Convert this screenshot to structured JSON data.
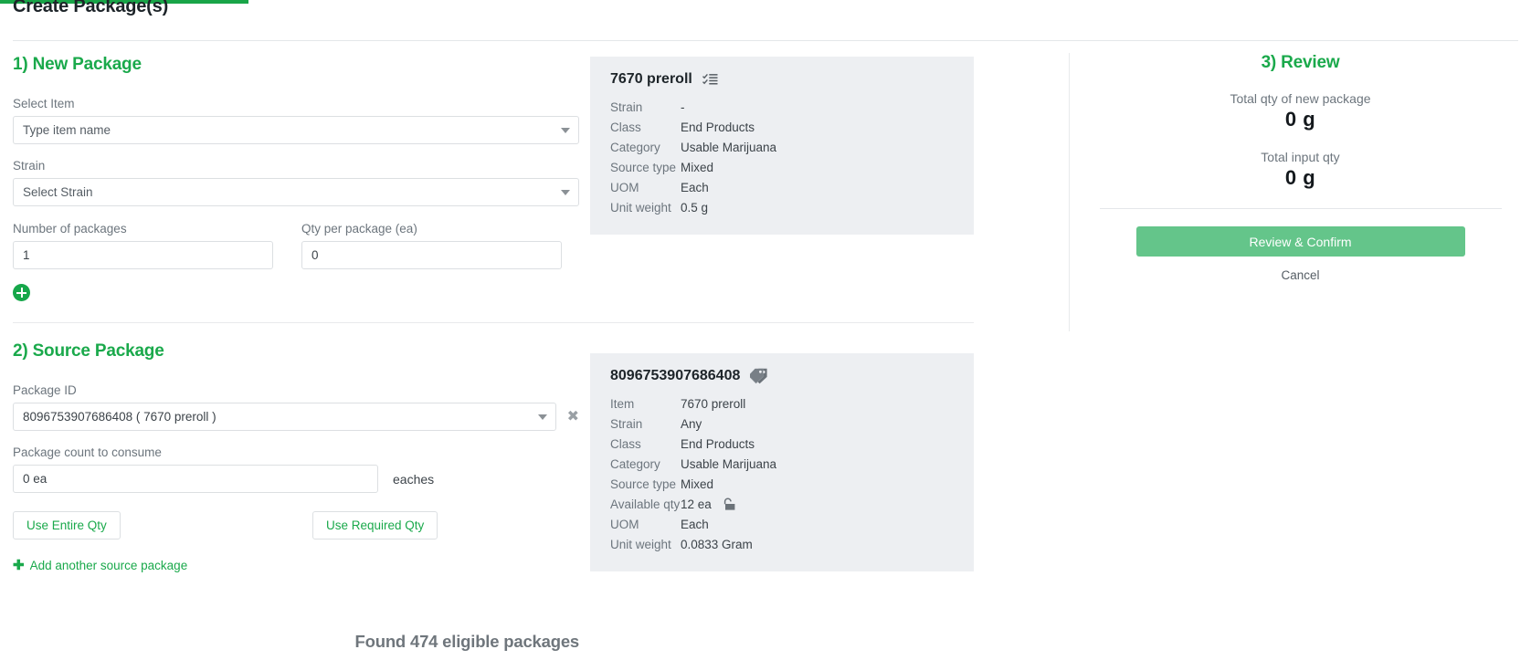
{
  "page": {
    "title": "Create Package(s)",
    "accent_green": "#19a548",
    "button_green": "#64c58a"
  },
  "new_package": {
    "heading": "1) New Package",
    "select_item": {
      "label": "Select Item",
      "value": "Type item name",
      "caret_icon": "chevron-down-icon"
    },
    "strain": {
      "label": "Strain",
      "value": "Select Strain",
      "caret_icon": "chevron-down-icon"
    },
    "number_of_packages": {
      "label": "Number of packages",
      "value": "1"
    },
    "qty_per_package": {
      "label": "Qty per package (ea)",
      "value": "0"
    },
    "add_icon": "plus-circle-icon"
  },
  "item_card": {
    "title": "7670 preroll",
    "title_icon": "checklist-icon",
    "rows": [
      {
        "key": "Strain",
        "value": "-"
      },
      {
        "key": "Class",
        "value": "End Products"
      },
      {
        "key": "Category",
        "value": "Usable Marijuana"
      },
      {
        "key": "Source type",
        "value": "Mixed"
      },
      {
        "key": "UOM",
        "value": "Each"
      },
      {
        "key": "Unit weight",
        "value": "0.5 g"
      }
    ]
  },
  "source_package": {
    "heading": "2) Source Package",
    "found_text": "Found 474 eligible packages",
    "package_id": {
      "label": "Package ID",
      "value": "8096753907686408 ( 7670 preroll )",
      "caret_icon": "chevron-down-icon",
      "clear_icon": "close-icon",
      "clear_glyph": "✖"
    },
    "package_count": {
      "label": "Package count to consume",
      "value": "0 ea",
      "unit": "eaches"
    },
    "use_entire_qty_label": "Use Entire Qty",
    "use_required_qty_label": "Use Required Qty",
    "add_another_label": "Add another source package",
    "add_another_glyph": "✚"
  },
  "source_card": {
    "title": "8096753907686408",
    "title_icon": "tag-icon",
    "rows": [
      {
        "key": "Item",
        "value": "7670 preroll"
      },
      {
        "key": "Strain",
        "value": "Any"
      },
      {
        "key": "Class",
        "value": "End Products"
      },
      {
        "key": "Category",
        "value": "Usable Marijuana"
      },
      {
        "key": "Source type",
        "value": "Mixed"
      },
      {
        "key": "Available qty",
        "value": "12 ea",
        "icon": "unlock-icon"
      },
      {
        "key": "UOM",
        "value": "Each"
      },
      {
        "key": "Unit weight",
        "value": "0.0833 Gram"
      }
    ]
  },
  "review": {
    "heading": "3) Review",
    "total_new_label": "Total qty of new package",
    "total_new_value": "0 g",
    "total_input_label": "Total input qty",
    "total_input_value": "0 g",
    "confirm_label": "Review & Confirm",
    "cancel_label": "Cancel"
  }
}
